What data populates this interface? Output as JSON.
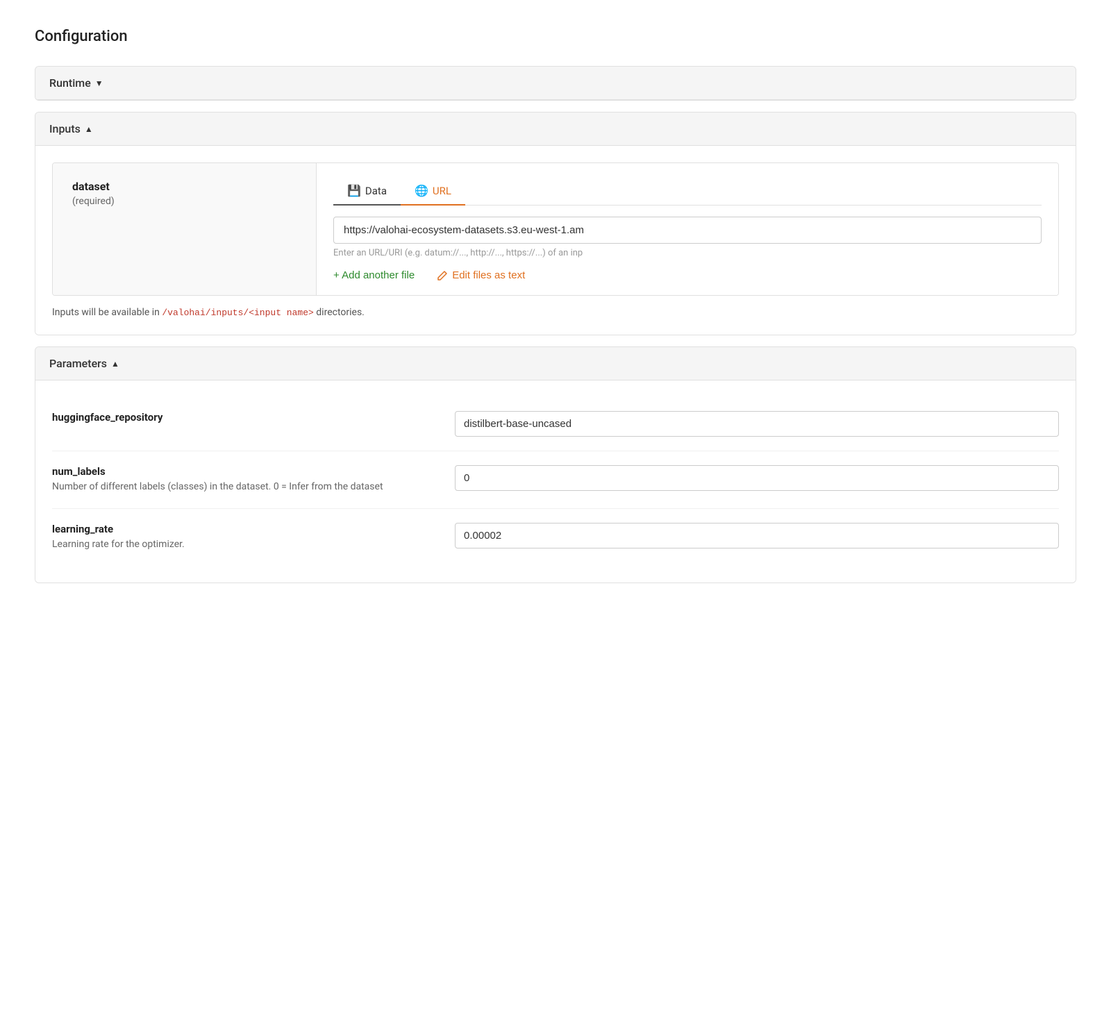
{
  "page": {
    "title": "Configuration"
  },
  "runtime_section": {
    "label": "Runtime",
    "chevron": "▼",
    "collapsed": true
  },
  "inputs_section": {
    "label": "Inputs",
    "chevron": "▲",
    "collapsed": false,
    "note_prefix": "Inputs will be available in ",
    "note_code": "/valohai/inputs/<input name>",
    "note_suffix": " directories.",
    "dataset_field": {
      "name": "dataset",
      "required_label": "(required)"
    },
    "tabs": [
      {
        "id": "data",
        "icon": "💾",
        "label": "Data",
        "active": false
      },
      {
        "id": "url",
        "icon": "🌐",
        "label": "URL",
        "active": true
      }
    ],
    "url_value": "https://valohai-ecosystem-datasets.s3.eu-west-1.am",
    "url_placeholder": "Enter an URL/URI (e.g. datum://..., http://..., https://...) of an inp",
    "add_file_label": "+ Add another file",
    "edit_text_label": "Edit files as text"
  },
  "parameters_section": {
    "label": "Parameters",
    "chevron": "▲",
    "collapsed": false,
    "params": [
      {
        "name": "huggingface_repository",
        "description": "",
        "value": "distilbert-base-uncased",
        "placeholder": ""
      },
      {
        "name": "num_labels",
        "description": "Number of different labels (classes) in the dataset. 0 = Infer from the dataset",
        "value": "0",
        "placeholder": ""
      },
      {
        "name": "learning_rate",
        "description": "Learning rate for the optimizer.",
        "value": "0.00002",
        "placeholder": ""
      }
    ]
  }
}
